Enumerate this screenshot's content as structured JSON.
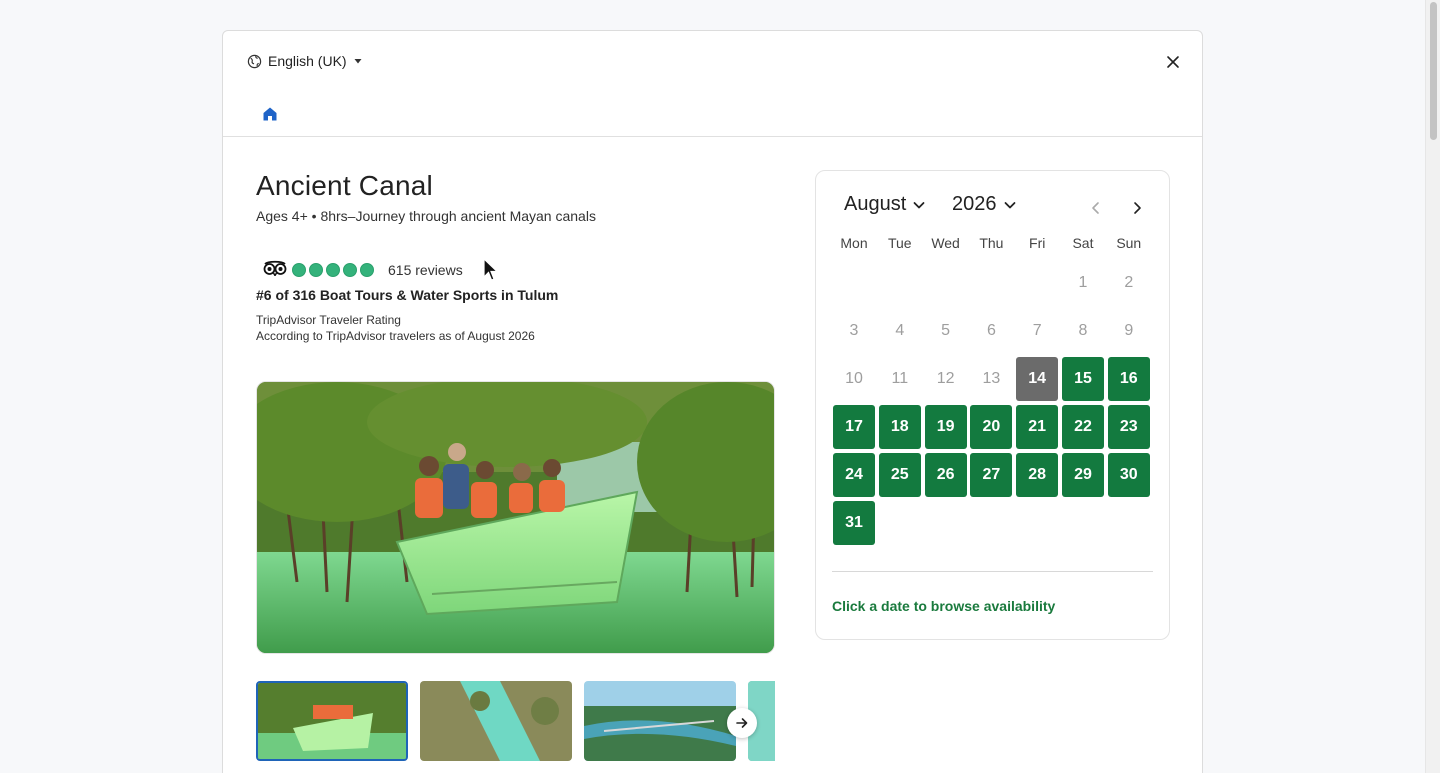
{
  "header": {
    "language": "English (UK)"
  },
  "tour": {
    "title": "Ancient Canal",
    "subtitle": "Ages 4+ • 8hrs–Journey through ancient Mayan canals",
    "rating_bubbles": 5,
    "reviews": "615 reviews",
    "rank": "#6 of 316 Boat Tours & Water Sports in Tulum",
    "rating_label": "TripAdvisor Traveler Rating",
    "rating_note": "According to TripAdvisor travelers as of August 2026"
  },
  "calendar": {
    "month": "August",
    "year": "2026",
    "weekdays": [
      "Mon",
      "Tue",
      "Wed",
      "Thu",
      "Fri",
      "Sat",
      "Sun"
    ],
    "leading_blanks": 5,
    "days_in_month": 31,
    "today": 14,
    "available_from": 15,
    "hint": "Click a date to browse availability",
    "colors": {
      "available": "#137a3f",
      "today": "#6b6b6b",
      "past": "#9e9e9e"
    }
  }
}
